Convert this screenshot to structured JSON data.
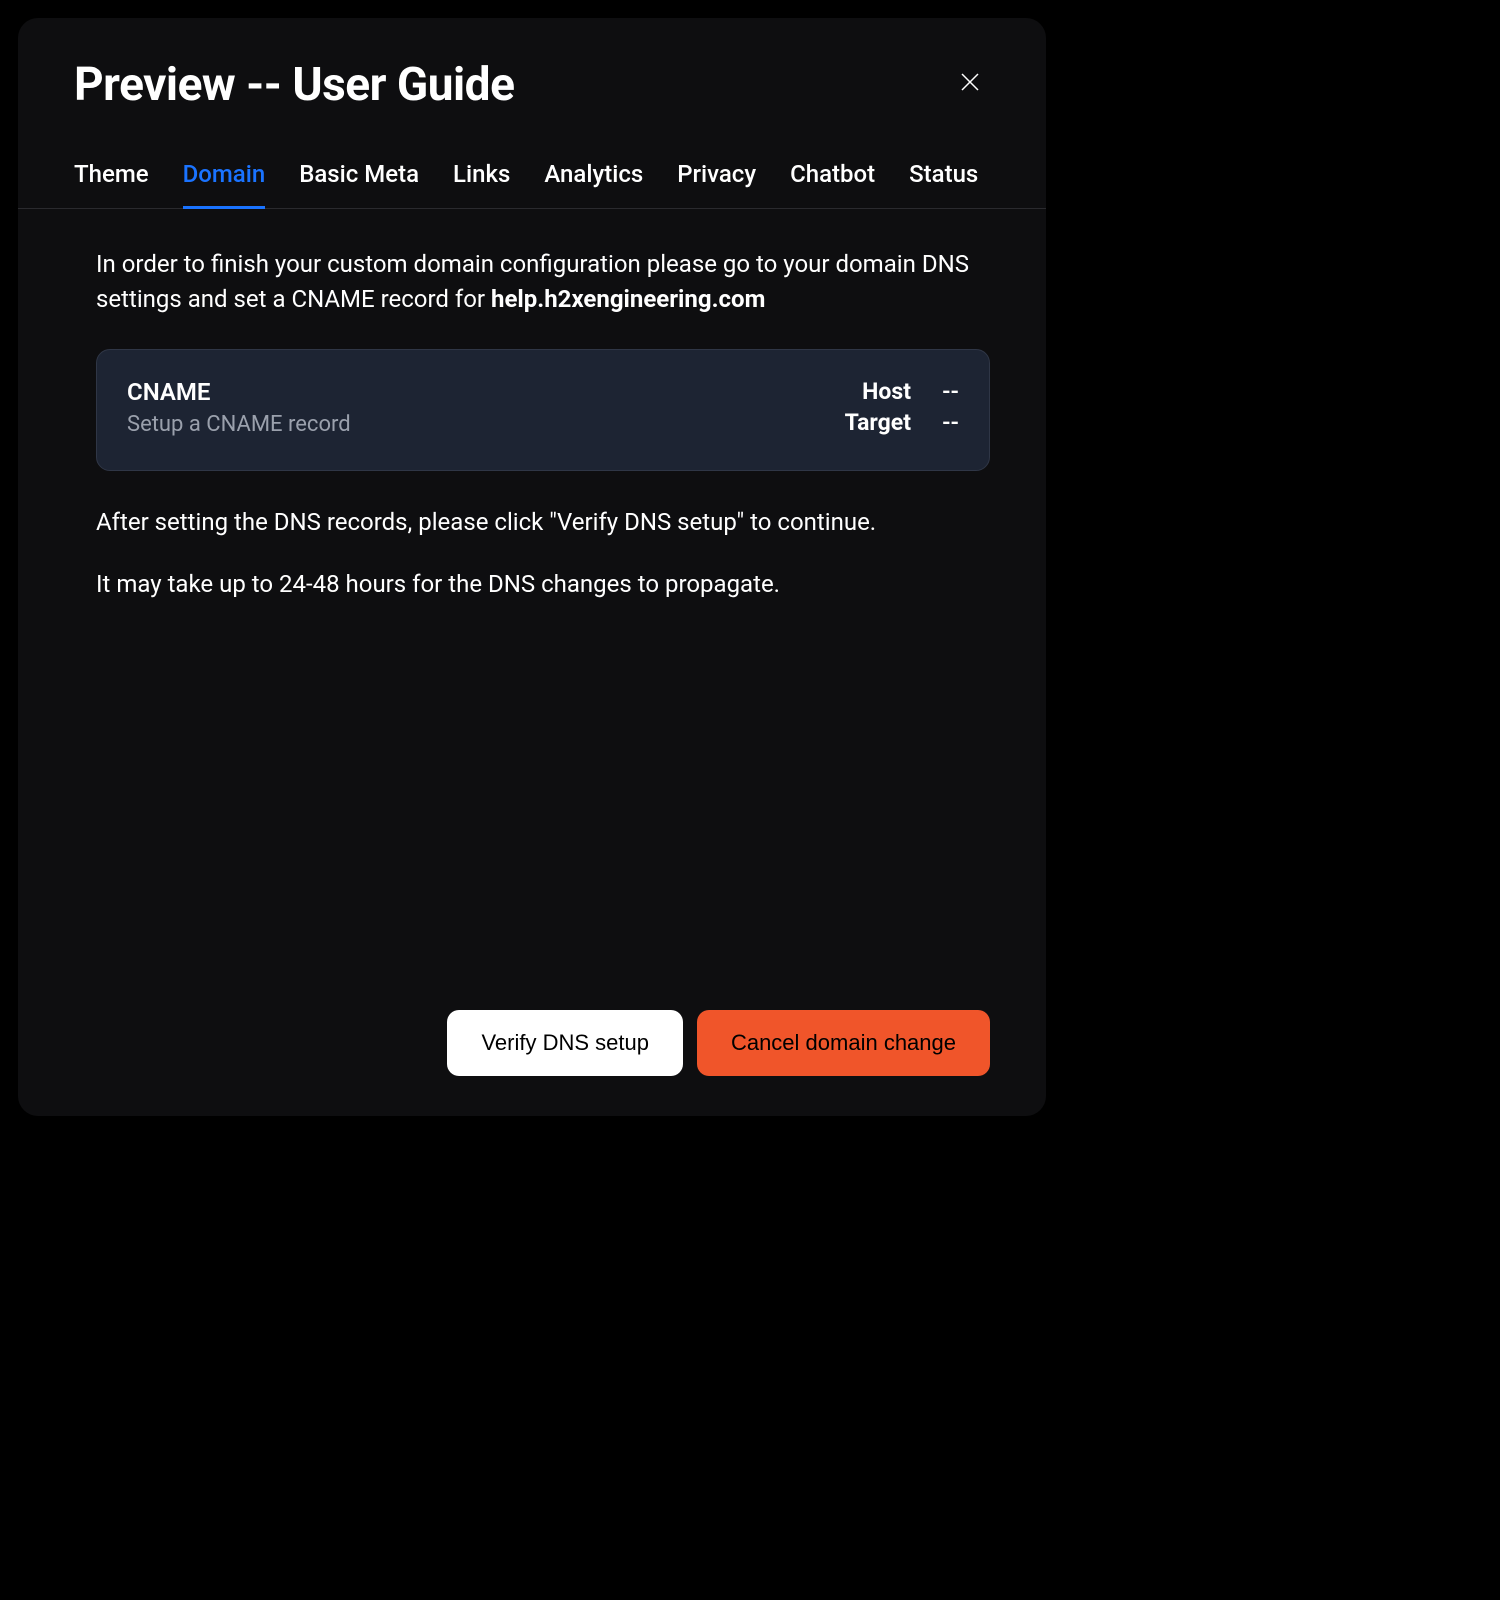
{
  "modal": {
    "title": "Preview -- User Guide"
  },
  "tabs": [
    {
      "label": "Theme",
      "active": false
    },
    {
      "label": "Domain",
      "active": true
    },
    {
      "label": "Basic Meta",
      "active": false
    },
    {
      "label": "Links",
      "active": false
    },
    {
      "label": "Analytics",
      "active": false
    },
    {
      "label": "Privacy",
      "active": false
    },
    {
      "label": "Chatbot",
      "active": false
    },
    {
      "label": "Status",
      "active": false
    }
  ],
  "domain": {
    "intro_prefix": "In order to finish your custom domain configuration please go to your domain DNS settings and set a CNAME record for ",
    "intro_domain": "help.h2xengineering.com",
    "cname": {
      "title": "CNAME",
      "subtitle": "Setup a CNAME record",
      "host_label": "Host",
      "host_value": "--",
      "target_label": "Target",
      "target_value": "--"
    },
    "after_text": "After setting the DNS records, please click \"Verify DNS setup\" to continue.",
    "propagate_text": "It may take up to 24-48 hours for the DNS changes to propagate."
  },
  "buttons": {
    "verify": "Verify DNS setup",
    "cancel": "Cancel domain change"
  }
}
